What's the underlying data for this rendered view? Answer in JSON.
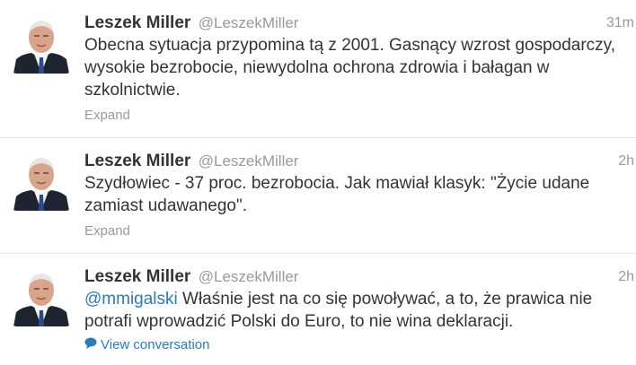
{
  "tweets": [
    {
      "fullname": "Leszek Miller",
      "username": "@LeszekMiller",
      "time": "31m",
      "text": "Obecna sytuacja przypomina tą z 2001. Gasnący wzrost gospodarczy, wysokie bezrobocie, niewydolna ochrona zdrowia i bałagan w szkolnictwie.",
      "action": "Expand"
    },
    {
      "fullname": "Leszek Miller",
      "username": "@LeszekMiller",
      "time": "2h",
      "text": "Szydłowiec - 37 proc. bezrobocia. Jak mawiał klasyk: \"Życie udane zamiast udawanego\".",
      "action": "Expand"
    },
    {
      "fullname": "Leszek Miller",
      "username": "@LeszekMiller",
      "time": "2h",
      "mention": "@mmigalski",
      "text": " Właśnie jest na co się powoływać, a to, że prawica nie potrafi wprowadzić Polski do Euro, to nie wina deklaracji.",
      "action": "View conversation",
      "action_icon": "speech-bubble-icon"
    }
  ],
  "colors": {
    "name": "#333333",
    "meta": "#999999",
    "link": "#2b7bb9",
    "divider": "#e8e8e8"
  }
}
